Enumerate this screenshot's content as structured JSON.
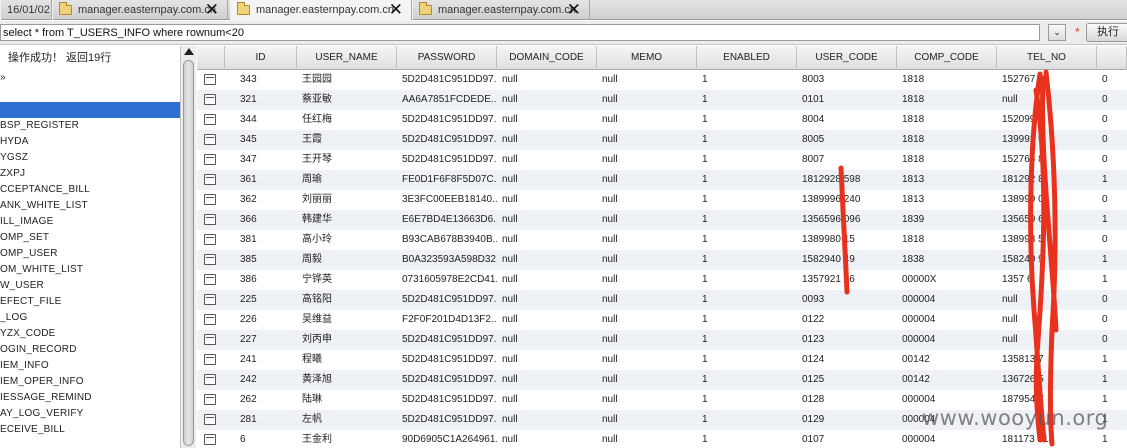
{
  "tabs": [
    {
      "label": "16/01/02",
      "active": false
    },
    {
      "label": "manager.easternpay.com.cn",
      "active": false
    },
    {
      "label": "manager.easternpay.com.cn",
      "active": true
    },
    {
      "label": "manager.easternpay.com.cn",
      "active": false
    }
  ],
  "query": {
    "value": "select * from T_USERS_INFO where rownum<20",
    "dropdown_glyph": "⌄",
    "star": "*",
    "execute_label": "执行"
  },
  "left_panel": {
    "status": "操作成功！ 返回19行",
    "tree_items": [
      {
        "label": "»",
        "selected": false
      },
      {
        "label": "",
        "selected": false
      },
      {
        "label": "",
        "selected": true
      },
      {
        "label": "BSP_REGISTER",
        "selected": false
      },
      {
        "label": "HYDA",
        "selected": false
      },
      {
        "label": "YGSZ",
        "selected": false
      },
      {
        "label": "ZXPJ",
        "selected": false
      },
      {
        "label": "CCEPTANCE_BILL",
        "selected": false
      },
      {
        "label": "ANK_WHITE_LIST",
        "selected": false
      },
      {
        "label": "ILL_IMAGE",
        "selected": false
      },
      {
        "label": "OMP_SET",
        "selected": false
      },
      {
        "label": "OMP_USER",
        "selected": false
      },
      {
        "label": "OM_WHITE_LIST",
        "selected": false
      },
      {
        "label": "W_USER",
        "selected": false
      },
      {
        "label": "EFECT_FILE",
        "selected": false
      },
      {
        "label": "_LOG",
        "selected": false
      },
      {
        "label": "YZX_CODE",
        "selected": false
      },
      {
        "label": "OGIN_RECORD",
        "selected": false
      },
      {
        "label": "IEM_INFO",
        "selected": false
      },
      {
        "label": "IEM_OPER_INFO",
        "selected": false
      },
      {
        "label": "IESSAGE_REMIND",
        "selected": false
      },
      {
        "label": "AY_LOG_VERIFY",
        "selected": false
      },
      {
        "label": "ECEIVE_BILL",
        "selected": false
      }
    ]
  },
  "grid": {
    "columns": [
      "",
      "ID",
      "USER_NAME",
      "PASSWORD",
      "DOMAIN_CODE",
      "MEMO",
      "ENABLED",
      "USER_CODE",
      "COMP_CODE",
      "TEL_NO",
      ""
    ],
    "rows": [
      [
        "343",
        "王园园",
        "5D2D481C951DD97...",
        "null",
        "null",
        "1",
        "8003",
        "1818",
        "152767 06",
        "0"
      ],
      [
        "321",
        "蔡亚敏",
        "AA6A7851FCDEDE...",
        "null",
        "null",
        "1",
        "0101",
        "1818",
        "null",
        "0"
      ],
      [
        "344",
        "任红梅",
        "5D2D481C951DD97...",
        "null",
        "null",
        "1",
        "8004",
        "1818",
        "152099 1",
        "0"
      ],
      [
        "345",
        "王霞",
        "5D2D481C951DD97...",
        "null",
        "null",
        "1",
        "8005",
        "1818",
        "139992 9",
        "0"
      ],
      [
        "347",
        "王开琴",
        "5D2D481C951DD97...",
        "null",
        "null",
        "1",
        "8007",
        "1818",
        "152766 8",
        "0"
      ],
      [
        "361",
        "周瑜",
        "FE0D1F6F8F5D07C...",
        "null",
        "null",
        "1",
        "1812928 598",
        "1813",
        "181292 8",
        "1"
      ],
      [
        "362",
        "刘丽丽",
        "3E3FC00EEB18140...",
        "null",
        "null",
        "1",
        "1389996 240",
        "1813",
        "138999 0",
        "0"
      ],
      [
        "366",
        "韩建华",
        "E6E7BD4E13663D6...",
        "null",
        "null",
        "1",
        "1356596 096",
        "1839",
        "135659 6",
        "1"
      ],
      [
        "381",
        "高小玲",
        "B93CAB678B3940B...",
        "null",
        "null",
        "1",
        "1389980 15",
        "1818",
        "138998 5",
        "0"
      ],
      [
        "385",
        "周毅",
        "B0A323593A598D32...",
        "null",
        "null",
        "1",
        "1582940 49",
        "1838",
        "158240 9",
        "1"
      ],
      [
        "386",
        "宁铧英",
        "0731605978E2CD41...",
        "null",
        "null",
        "1",
        "1357921 36",
        "00000X",
        "1357 6",
        "1"
      ],
      [
        "225",
        "高铭阳",
        "5D2D481C951DD97...",
        "null",
        "null",
        "1",
        "0093",
        "000004",
        "null",
        "0"
      ],
      [
        "226",
        "吴维益",
        "F2F0F201D4D13F2...",
        "null",
        "null",
        "1",
        "0122",
        "000004",
        "null",
        "0"
      ],
      [
        "227",
        "刘丙申",
        "5D2D481C951DD97...",
        "null",
        "null",
        "1",
        "0123",
        "000004",
        "null",
        "0"
      ],
      [
        "241",
        "程曦",
        "5D2D481C951DD97...",
        "null",
        "null",
        "1",
        "0124",
        "00142",
        "135813 7",
        "1"
      ],
      [
        "242",
        "黄泽旭",
        "5D2D481C951DD97...",
        "null",
        "null",
        "1",
        "0125",
        "00142",
        "136726 5",
        "1"
      ],
      [
        "262",
        "陆琳",
        "5D2D481C951DD97...",
        "null",
        "null",
        "1",
        "0128",
        "000004",
        "187954 7",
        "1"
      ],
      [
        "281",
        "左帆",
        "5D2D481C951DD97...",
        "null",
        "null",
        "1",
        "0129",
        "000004",
        "",
        "1"
      ],
      [
        "6",
        "王金利",
        "90D6905C1A264961...",
        "null",
        "null",
        "1",
        "0107",
        "000004",
        "181173 515",
        "1"
      ]
    ]
  },
  "watermark": "www.wooyun.org",
  "colors": {
    "selection": "#2f6fd1",
    "redaction": "#e8321e",
    "row_alt": "#eef1f6"
  }
}
